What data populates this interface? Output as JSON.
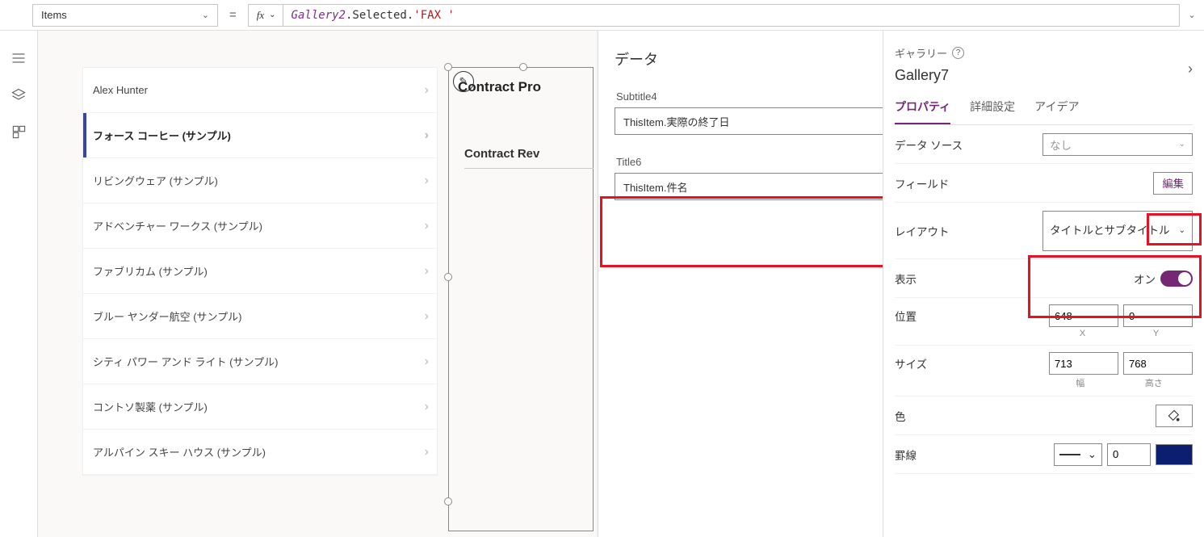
{
  "formula": {
    "property": "Items",
    "fx_label": "fx",
    "expr_obj": "Gallery2",
    "expr_rest": ".Selected.",
    "expr_lit": "'FAX '"
  },
  "gallery1": {
    "items": [
      "Alex Hunter",
      "フォース コーヒー (サンプル)",
      "リビングウェア (サンプル)",
      "アドベンチャー ワークス (サンプル)",
      "ファブリカム (サンプル)",
      "ブルー ヤンダー航空 (サンプル)",
      "シティ パワー アンド ライト (サンプル)",
      "コントソ製薬 (サンプル)",
      "アルパイン スキー ハウス (サンプル)"
    ],
    "selected_index": 1
  },
  "gallery2": {
    "header": "Contract Pro",
    "row1": "Contract Rev"
  },
  "data_panel": {
    "title": "データ",
    "fields": [
      {
        "label": "Subtitle4",
        "value": "ThisItem.実際の終了日"
      },
      {
        "label": "Title6",
        "value": "ThisItem.件名"
      }
    ]
  },
  "props": {
    "breadcrumb": "ギャラリー",
    "name": "Gallery7",
    "tabs": {
      "properties": "プロパティ",
      "advanced": "詳細設定",
      "ideas": "アイデア"
    },
    "data_source": {
      "label": "データ ソース",
      "value": "なし"
    },
    "fields": {
      "label": "フィールド",
      "action": "編集"
    },
    "layout": {
      "label": "レイアウト",
      "value": "タイトルとサブタイトル"
    },
    "visible": {
      "label": "表示",
      "value": "オン"
    },
    "position": {
      "label": "位置",
      "x": "648",
      "y": "0",
      "xlabel": "X",
      "ylabel": "Y"
    },
    "size": {
      "label": "サイズ",
      "w": "713",
      "h": "768",
      "wlabel": "幅",
      "hlabel": "高さ"
    },
    "color": {
      "label": "色"
    },
    "border": {
      "label": "罫線",
      "width": "0"
    }
  }
}
